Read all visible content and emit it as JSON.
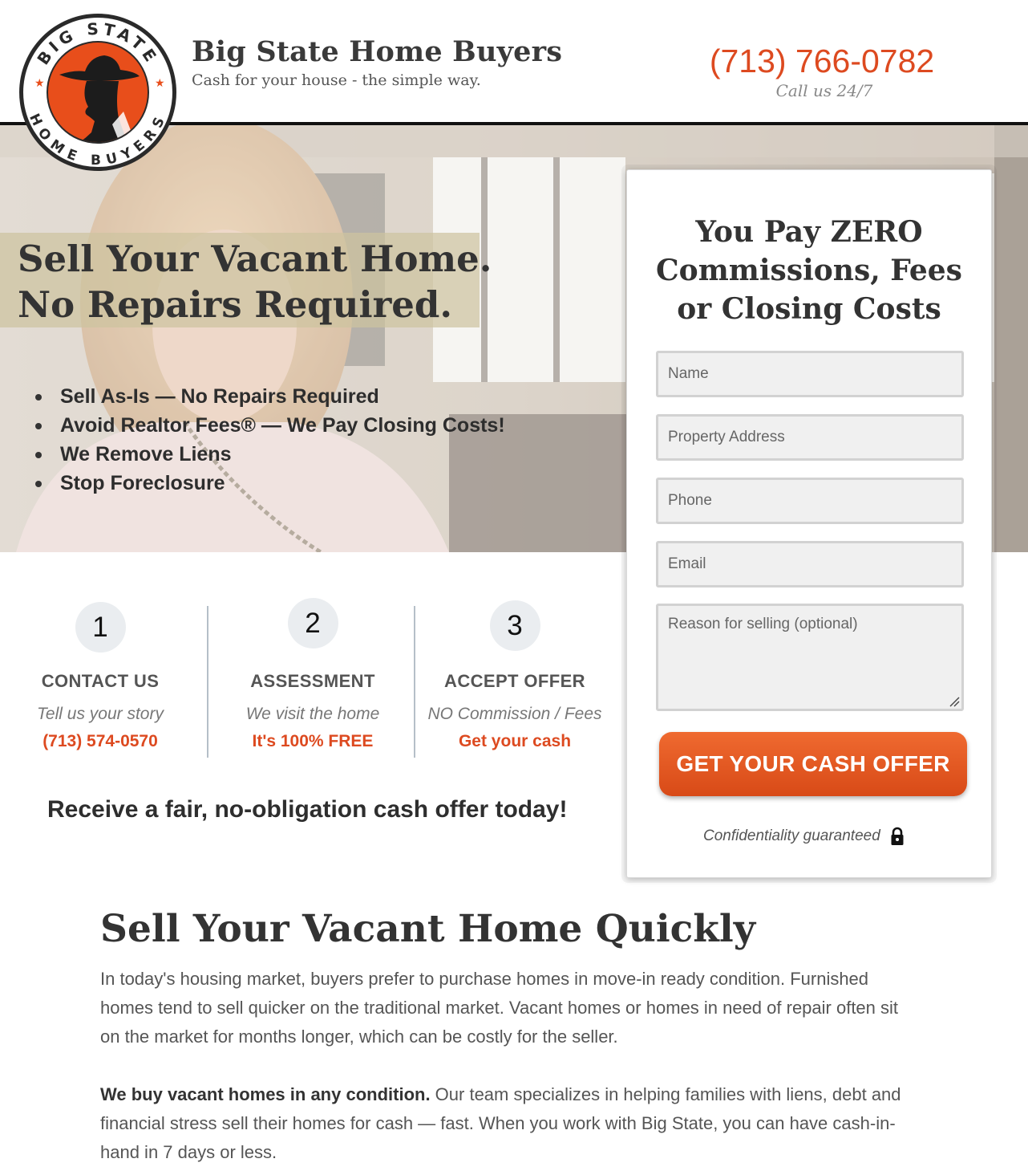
{
  "header": {
    "brand_name": "Big State Home Buyers",
    "tagline": "Cash for your house - the simple way.",
    "phone": "(713) 766-0782",
    "call_note": "Call us 24/7",
    "logo": {
      "top_text": "BIG STATE",
      "bottom_text": "HOME BUYERS",
      "icon": "cowboy-silhouette-logo"
    }
  },
  "hero": {
    "title_line1": "Sell Your Vacant Home.",
    "title_line2": "No Repairs Required.",
    "bullets": [
      "Sell As-Is — No Repairs Required",
      "Avoid Realtor Fees® — We Pay Closing Costs!",
      "We Remove Liens",
      "Stop Foreclosure"
    ]
  },
  "steps": [
    {
      "number": "1",
      "title": "CONTACT US",
      "desc": "Tell us your story",
      "link": "(713) 574-0570"
    },
    {
      "number": "2",
      "title": "ASSESSMENT",
      "desc": "We visit the home",
      "link": "It's 100% FREE"
    },
    {
      "number": "3",
      "title": "ACCEPT OFFER",
      "desc": "NO Commission / Fees",
      "link": "Get your cash"
    }
  ],
  "receive_text": "Receive a fair, no-obligation cash offer today!",
  "form": {
    "title_line1": "You Pay ZERO",
    "title_line2": "Commissions, Fees",
    "title_line3": "or Closing Costs",
    "name_placeholder": "Name",
    "address_placeholder": "Property Address",
    "phone_placeholder": "Phone",
    "email_placeholder": "Email",
    "reason_placeholder": "Reason for selling (optional)",
    "submit_label": "GET YOUR CASH OFFER",
    "confidential_text": "Confidentiality guaranteed"
  },
  "content": {
    "title": "Sell Your Vacant Home Quickly",
    "para1": "In today's housing market, buyers prefer to purchase homes in move-in ready condition. Furnished homes tend to sell quicker on the traditional market. Vacant homes or homes in need of repair often sit on the market for months longer, which can be costly for the seller.",
    "para2_bold": "We buy vacant homes in any condition.",
    "para2_rest": " Our team specializes in helping families with liens, debt and financial stress sell their homes for cash — fast. When you work with Big State, you can have cash-in-hand in 7 days or less."
  },
  "colors": {
    "accent_orange": "#dd4a20",
    "button_orange": "#e55a22",
    "header_rule": "#111111",
    "step_circle": "#eaedf0"
  }
}
